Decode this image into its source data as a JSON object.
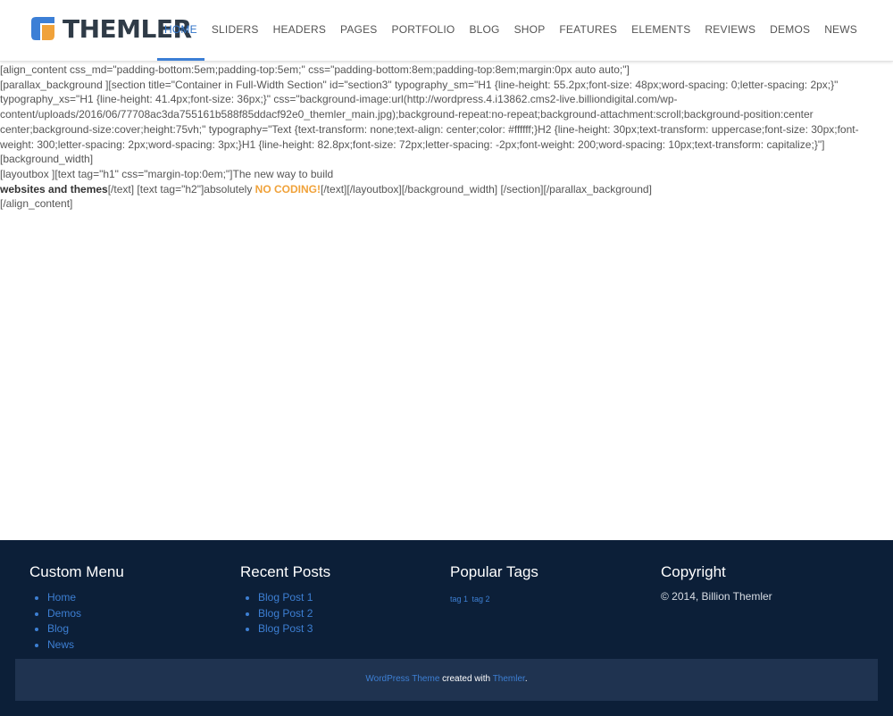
{
  "brand": {
    "logo_text": "THEMLER",
    "colors": {
      "blue": "#3c7fd6",
      "orange": "#f0a23a"
    }
  },
  "nav": {
    "items": [
      "HOME",
      "SLIDERS",
      "HEADERS",
      "PAGES",
      "PORTFOLIO",
      "BLOG",
      "SHOP",
      "FEATURES",
      "ELEMENTS",
      "REVIEWS",
      "DEMOS",
      "NEWS"
    ],
    "active": "HOME"
  },
  "content": {
    "line1": "[align_content css_md=\"padding-bottom:5em;padding-top:5em;\" css=\"padding-bottom:8em;padding-top:8em;margin:0px auto auto;\"]",
    "line2": "[parallax_background ][section title=\"Container in Full-Width Section\" id=\"section3\" typography_sm=\"H1 {line-height: 55.2px;font-size: 48px;word-spacing: 0;letter-spacing: 2px;}\" typography_xs=\"H1 {line-height: 41.4px;font-size: 36px;}\" css=\"background-image:url(http://wordpress.4.i13862.cms2-live.billiondigital.com/wp-content/uploads/2016/06/77708ac3da755161b588f85ddacf92e0_themler_main.jpg);background-repeat:no-repeat;background-attachment:scroll;background-position:center center;background-size:cover;height:75vh;\" typography=\"Text {text-transform: none;text-align: center;color: #ffffff;}H2 {line-height: 30px;text-transform: uppercase;font-size: 30px;font-weight: 300;letter-spacing: 2px;word-spacing: 3px;}H1 {line-height: 82.8px;font-size: 72px;letter-spacing: -2px;font-weight: 200;word-spacing: 10px;text-transform: capitalize;}\"] [background_width]",
    "line3": "[layoutbox ][text tag=\"h1\" css=\"margin-top:0em;\"]The new way to build",
    "line4_bold": "websites and themes",
    "line4_mid": "[/text] [text tag=\"h2\"]absolutely ",
    "line4_highlight": "NO CODING!",
    "line4_end": "[/text][/layoutbox][/background_width] [/section][/parallax_background]",
    "line5": "[/align_content]"
  },
  "footer": {
    "custom_menu": {
      "title": "Custom Menu",
      "items": [
        "Home",
        "Demos",
        "Blog",
        "News"
      ]
    },
    "recent_posts": {
      "title": "Recent Posts",
      "items": [
        "Blog Post 1",
        "Blog Post 2",
        "Blog Post 3"
      ]
    },
    "popular_tags": {
      "title": "Popular Tags",
      "tags": [
        "tag 1",
        "tag 2"
      ]
    },
    "copyright": {
      "title": "Copyright",
      "text": "© 2014, Billion Themler"
    },
    "bottom": {
      "link1": "WordPress Theme",
      "middle": " created with ",
      "link2": "Themler",
      "end": "."
    }
  }
}
